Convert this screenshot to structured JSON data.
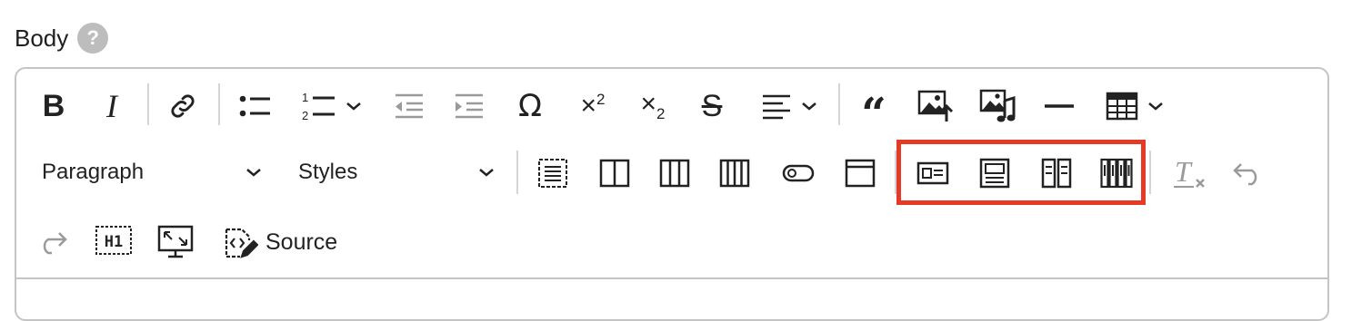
{
  "field": {
    "label": "Body",
    "help_glyph": "?"
  },
  "toolbar": {
    "row1": [
      {
        "name": "bold-icon",
        "label": "Bold"
      },
      {
        "name": "italic-icon",
        "label": "Italic"
      },
      {
        "name": "link-icon",
        "label": "Link"
      },
      {
        "name": "bulleted-list-icon",
        "label": "Bulleted List"
      },
      {
        "name": "numbered-list-icon",
        "label": "Numbered List"
      },
      {
        "name": "outdent-icon",
        "label": "Decrease indent"
      },
      {
        "name": "indent-icon",
        "label": "Increase indent"
      },
      {
        "name": "special-characters-icon",
        "label": "Special characters"
      },
      {
        "name": "superscript-icon",
        "label": "Superscript"
      },
      {
        "name": "subscript-icon",
        "label": "Subscript"
      },
      {
        "name": "strikethrough-icon",
        "label": "Strikethrough"
      },
      {
        "name": "text-alignment-icon",
        "label": "Text alignment"
      },
      {
        "name": "block-quote-icon",
        "label": "Block quote"
      },
      {
        "name": "insert-image-icon",
        "label": "Insert image"
      },
      {
        "name": "insert-media-icon",
        "label": "Insert media"
      },
      {
        "name": "horizontal-line-icon",
        "label": "Horizontal line"
      },
      {
        "name": "insert-table-icon",
        "label": "Insert table"
      }
    ],
    "heading_dropdown": {
      "value": "Paragraph"
    },
    "styles_dropdown": {
      "value": "Styles"
    },
    "source_button": {
      "label": "Source"
    }
  },
  "colors": {
    "highlight": "#e53a25",
    "border": "#c4c4c4",
    "disabled": "#9a9a9a"
  }
}
